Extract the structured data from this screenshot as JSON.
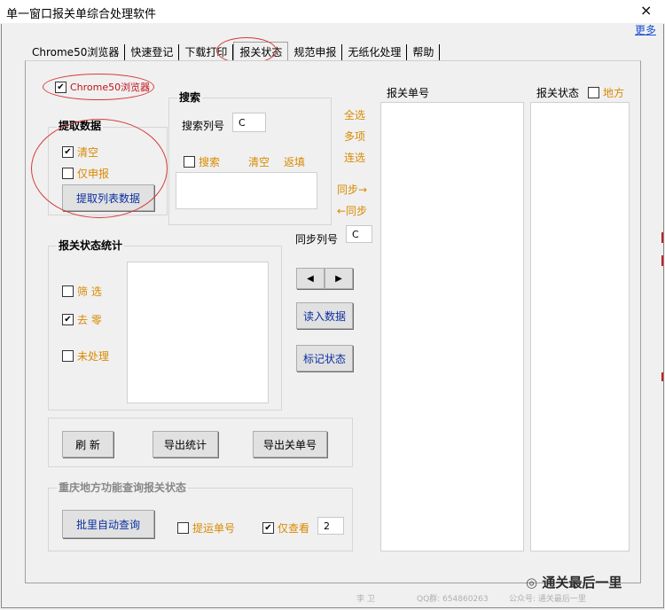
{
  "window": {
    "title": "单一窗口报关单综合处理软件",
    "close": "×",
    "more_link": "更多"
  },
  "tabs": [
    {
      "label": "Chrome50浏览器"
    },
    {
      "label": "快速登记"
    },
    {
      "label": "下载打印"
    },
    {
      "label": "报关状态",
      "active": true
    },
    {
      "label": "规范申报"
    },
    {
      "label": "无纸化处理"
    },
    {
      "label": "帮助"
    }
  ],
  "browser_check": {
    "label": "Chrome50浏览器",
    "checked": true
  },
  "extract": {
    "title": "提取数据",
    "clear_label": "清空",
    "clear_checked": true,
    "only_declare_label": "仅申报",
    "only_declare_checked": false,
    "button": "提取列表数据"
  },
  "search": {
    "title": "搜索",
    "column_label": "搜索列号",
    "column_value": "C",
    "search_check_label": "搜索",
    "search_checked": false,
    "clear_link": "清空",
    "backfill_link": "返填"
  },
  "select_links": {
    "all": "全选",
    "multi": "多项",
    "range": "连选",
    "sync_right": "同步→",
    "sync_left": "←同步"
  },
  "sync_column": {
    "label": "同步列号",
    "value": "C"
  },
  "stats": {
    "title": "报关状态统计",
    "filter_label": "筛 选",
    "filter_checked": false,
    "dedup_label": "去 零",
    "dedup_checked": true,
    "unprocessed_label": "未处理",
    "unprocessed_checked": false
  },
  "nav": {
    "prev": "◀",
    "next": "▶"
  },
  "buttons": {
    "read_data": "读入数据",
    "mark_status": "标记状态",
    "refresh": "刷 新",
    "export_stats": "导出统计",
    "export_decl": "导出关单号"
  },
  "list_headers": {
    "decl_no": "报关单号",
    "status": "报关状态",
    "local_label": "地方",
    "local_checked": false
  },
  "chongqing": {
    "title": "重庆地方功能查询报关状态",
    "batch_button": "批里自动查询",
    "shipping_label": "提运单号",
    "shipping_checked": false,
    "only_view_label": "仅查看",
    "only_view_checked": true,
    "only_view_value": "2"
  },
  "footer": {
    "name": "李 卫",
    "qq": "QQ群: 654860263",
    "public": "公众号: 通关最后一里",
    "wechat_brand": "通关最后一里"
  }
}
